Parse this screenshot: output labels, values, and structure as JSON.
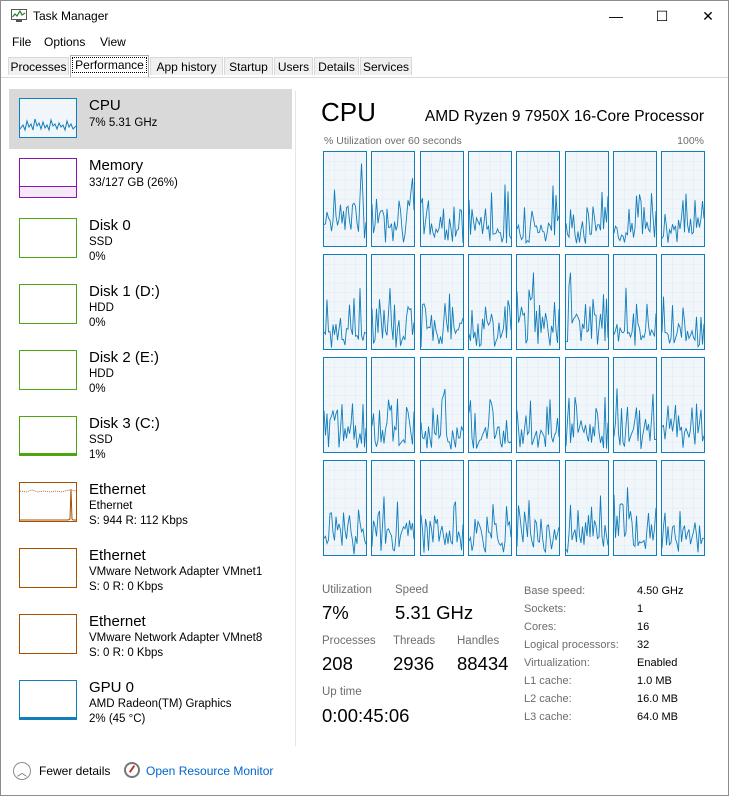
{
  "window": {
    "title": "Task Manager",
    "controls": {
      "minimize": "—",
      "maximize": "☐",
      "close": "✕"
    }
  },
  "menu": [
    "File",
    "Options",
    "View"
  ],
  "tabs": [
    "Processes",
    "Performance",
    "App history",
    "Startup",
    "Users",
    "Details",
    "Services"
  ],
  "active_tab": "Performance",
  "sidebar": [
    {
      "title": "CPU",
      "line1": "7%  5.31 GHz",
      "line2": "",
      "color": "#117dbb",
      "selected": true
    },
    {
      "title": "Memory",
      "line1": "33/127 GB (26%)",
      "line2": "",
      "color": "#8b12ae",
      "selected": false
    },
    {
      "title": "Disk 0",
      "line1": "SSD",
      "line2": "0%",
      "color": "#4da60c",
      "selected": false
    },
    {
      "title": "Disk 1 (D:)",
      "line1": "HDD",
      "line2": "0%",
      "color": "#4da60c",
      "selected": false
    },
    {
      "title": "Disk 2 (E:)",
      "line1": "HDD",
      "line2": "0%",
      "color": "#4da60c",
      "selected": false
    },
    {
      "title": "Disk 3 (C:)",
      "line1": "SSD",
      "line2": "1%",
      "color": "#4da60c",
      "selected": false
    },
    {
      "title": "Ethernet",
      "line1": "Ethernet",
      "line2": "S: 944  R: 112 Kbps",
      "color": "#a74f01",
      "selected": false
    },
    {
      "title": "Ethernet",
      "line1": "VMware Network Adapter VMnet1",
      "line2": "S: 0  R: 0 Kbps",
      "color": "#a74f01",
      "selected": false
    },
    {
      "title": "Ethernet",
      "line1": "VMware Network Adapter VMnet8",
      "line2": "S: 0  R: 0 Kbps",
      "color": "#a74f01",
      "selected": false
    },
    {
      "title": "GPU 0",
      "line1": "AMD Radeon(TM) Graphics",
      "line2": "2%  (45 °C)",
      "color": "#117dbb",
      "selected": false
    }
  ],
  "cpu": {
    "title": "CPU",
    "model": "AMD Ryzen 9 7950X 16-Core Processor",
    "util_caption": "% Utilization over 60 seconds",
    "util_max": "100%",
    "logical_graph_count": 32,
    "stats": {
      "utilization_label": "Utilization",
      "utilization": "7%",
      "speed_label": "Speed",
      "speed": "5.31 GHz",
      "processes_label": "Processes",
      "processes": "208",
      "threads_label": "Threads",
      "threads": "2936",
      "handles_label": "Handles",
      "handles": "88434",
      "uptime_label": "Up time",
      "uptime": "0:00:45:06"
    },
    "details": [
      {
        "label": "Base speed:",
        "value": "4.50 GHz"
      },
      {
        "label": "Sockets:",
        "value": "1"
      },
      {
        "label": "Cores:",
        "value": "16"
      },
      {
        "label": "Logical processors:",
        "value": "32"
      },
      {
        "label": "Virtualization:",
        "value": "Enabled"
      },
      {
        "label": "L1 cache:",
        "value": "1.0 MB"
      },
      {
        "label": "L2 cache:",
        "value": "16.0 MB"
      },
      {
        "label": "L3 cache:",
        "value": "64.0 MB"
      }
    ]
  },
  "footer": {
    "fewer_details": "Fewer details",
    "open_resource_monitor": "Open Resource Monitor"
  }
}
